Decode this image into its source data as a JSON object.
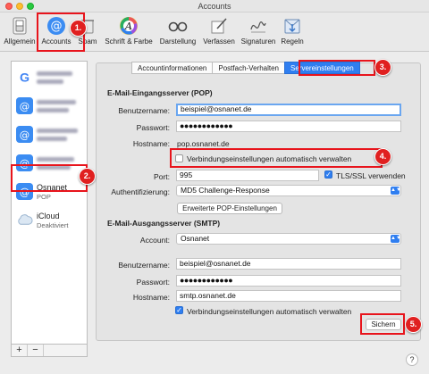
{
  "window": {
    "title": "Accounts"
  },
  "toolbar": {
    "items": [
      {
        "label": "Allgemein",
        "icon": "switch-icon"
      },
      {
        "label": "Accounts",
        "icon": "at-sign-icon"
      },
      {
        "label": "Spam",
        "icon": "trash-icon"
      },
      {
        "label": "Schrift & Farbe",
        "icon": "font-color-icon"
      },
      {
        "label": "Darstellung",
        "icon": "glasses-icon"
      },
      {
        "label": "Verfassen",
        "icon": "compose-icon"
      },
      {
        "label": "Signaturen",
        "icon": "signature-icon"
      },
      {
        "label": "Regeln",
        "icon": "rules-icon"
      }
    ]
  },
  "sidebar": {
    "accounts": [
      {
        "icon": "google-icon"
      },
      {
        "icon": "at-sign-icon"
      },
      {
        "icon": "at-sign-icon"
      },
      {
        "icon": "at-sign-icon"
      },
      {
        "name": "Osnanet",
        "subtitle": "POP",
        "icon": "at-sign-icon"
      },
      {
        "name": "iCloud",
        "subtitle": "Deaktiviert",
        "icon": "cloud-icon"
      }
    ],
    "add_label": "+",
    "remove_label": "−"
  },
  "tabs": [
    "Accountinformationen",
    "Postfach-Verhalten",
    "Servereinstellungen"
  ],
  "incoming": {
    "section_title": "E-Mail-Eingangsserver (POP)",
    "username_label": "Benutzername:",
    "username_value": "beispiel@osnanet.de",
    "password_label": "Passwort:",
    "password_value": "●●●●●●●●●●●●",
    "hostname_label": "Hostname:",
    "hostname_value": "pop.osnanet.de",
    "auto_manage_label": "Verbindungseinstellungen automatisch verwalten",
    "port_label": "Port:",
    "port_value": "995",
    "tls_label": "TLS/SSL verwenden",
    "auth_label": "Authentifizierung:",
    "auth_value": "MD5 Challenge-Response",
    "advanced_button": "Erweiterte POP-Einstellungen"
  },
  "outgoing": {
    "section_title": "E-Mail-Ausgangsserver (SMTP)",
    "account_label": "Account:",
    "account_value": "Osnanet",
    "username_label": "Benutzername:",
    "username_value": "beispiel@osnanet.de",
    "password_label": "Passwort:",
    "password_value": "●●●●●●●●●●●●",
    "hostname_label": "Hostname:",
    "hostname_value": "smtp.osnanet.de",
    "auto_manage_label": "Verbindungseinstellungen automatisch verwalten"
  },
  "save_button": "Sichern",
  "help_label": "?",
  "steps": [
    "1.",
    "2.",
    "3.",
    "4.",
    "5."
  ],
  "colors": {
    "highlight": "#e8141c",
    "accent": "#2f7ef0",
    "badge": "#e02020"
  }
}
